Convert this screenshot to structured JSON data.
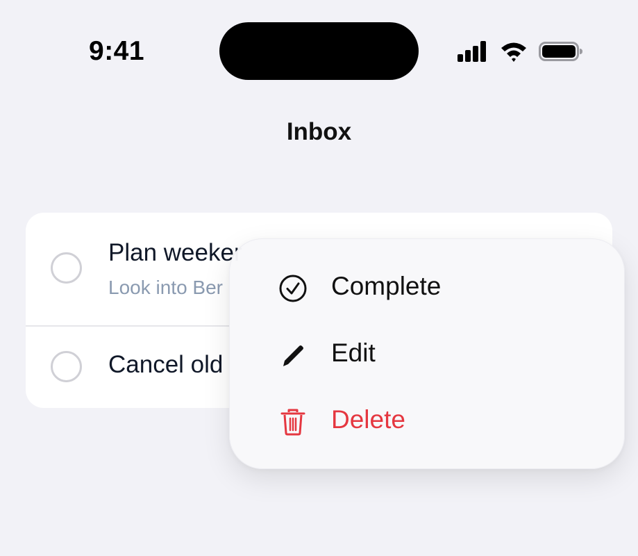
{
  "status_bar": {
    "time": "9:41",
    "icons": [
      "cellular-signal-icon",
      "wifi-icon",
      "battery-icon"
    ]
  },
  "screen": {
    "title": "Inbox"
  },
  "tasks": [
    {
      "title": "Plan weeker",
      "subtitle": "Look into Ber",
      "completed": false
    },
    {
      "title": "Cancel old",
      "subtitle": "",
      "completed": false
    }
  ],
  "context_menu": {
    "items": [
      {
        "label": "Complete",
        "icon": "checkmark-circle-icon"
      },
      {
        "label": "Edit",
        "icon": "pencil-icon"
      },
      {
        "label": "Delete",
        "icon": "trash-icon",
        "color": "#e53740"
      }
    ]
  },
  "colors": {
    "background": "#f2f2f7",
    "card": "#ffffff",
    "destructive": "#e53740",
    "subtitle": "#8a9ab0"
  }
}
